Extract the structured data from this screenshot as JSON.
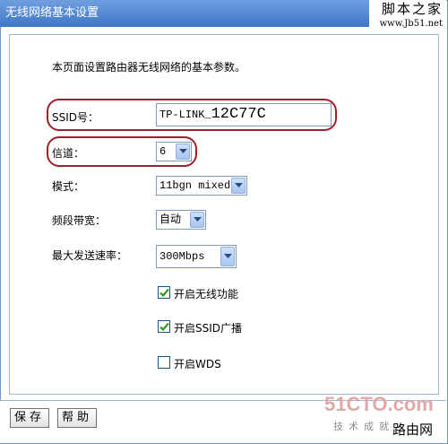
{
  "window": {
    "title": "无线网络基本设置"
  },
  "watermark": {
    "site_name": "脚本之家",
    "site_url": "www.Jb51.net"
  },
  "intro": "本页面设置路由器无线网络的基本参数。",
  "form": {
    "ssid": {
      "label": "SSID号：",
      "value_prefix": "TP-LINK_",
      "value_suffix": "12C77C"
    },
    "channel": {
      "label": "信道：",
      "value": "6"
    },
    "mode": {
      "label": "模式：",
      "value": "11bgn mixed"
    },
    "bandwidth": {
      "label": "频段带宽：",
      "value": "自动"
    },
    "max_rate": {
      "label": "最大发送速率：",
      "value": "300Mbps"
    },
    "checkboxes": [
      {
        "label": "开启无线功能",
        "checked": true
      },
      {
        "label": "开启SSID广播",
        "checked": true
      },
      {
        "label": "开启WDS",
        "checked": false
      }
    ]
  },
  "buttons": {
    "save": "保存",
    "help": "帮助"
  },
  "logo": {
    "brand": "51CTO.com",
    "tagline": "技术成就",
    "corner_text": "路由网"
  },
  "colors": {
    "titlebar": "#3f76c6",
    "highlight": "#a31d2d",
    "brand_logo": "#e0a9a9"
  }
}
